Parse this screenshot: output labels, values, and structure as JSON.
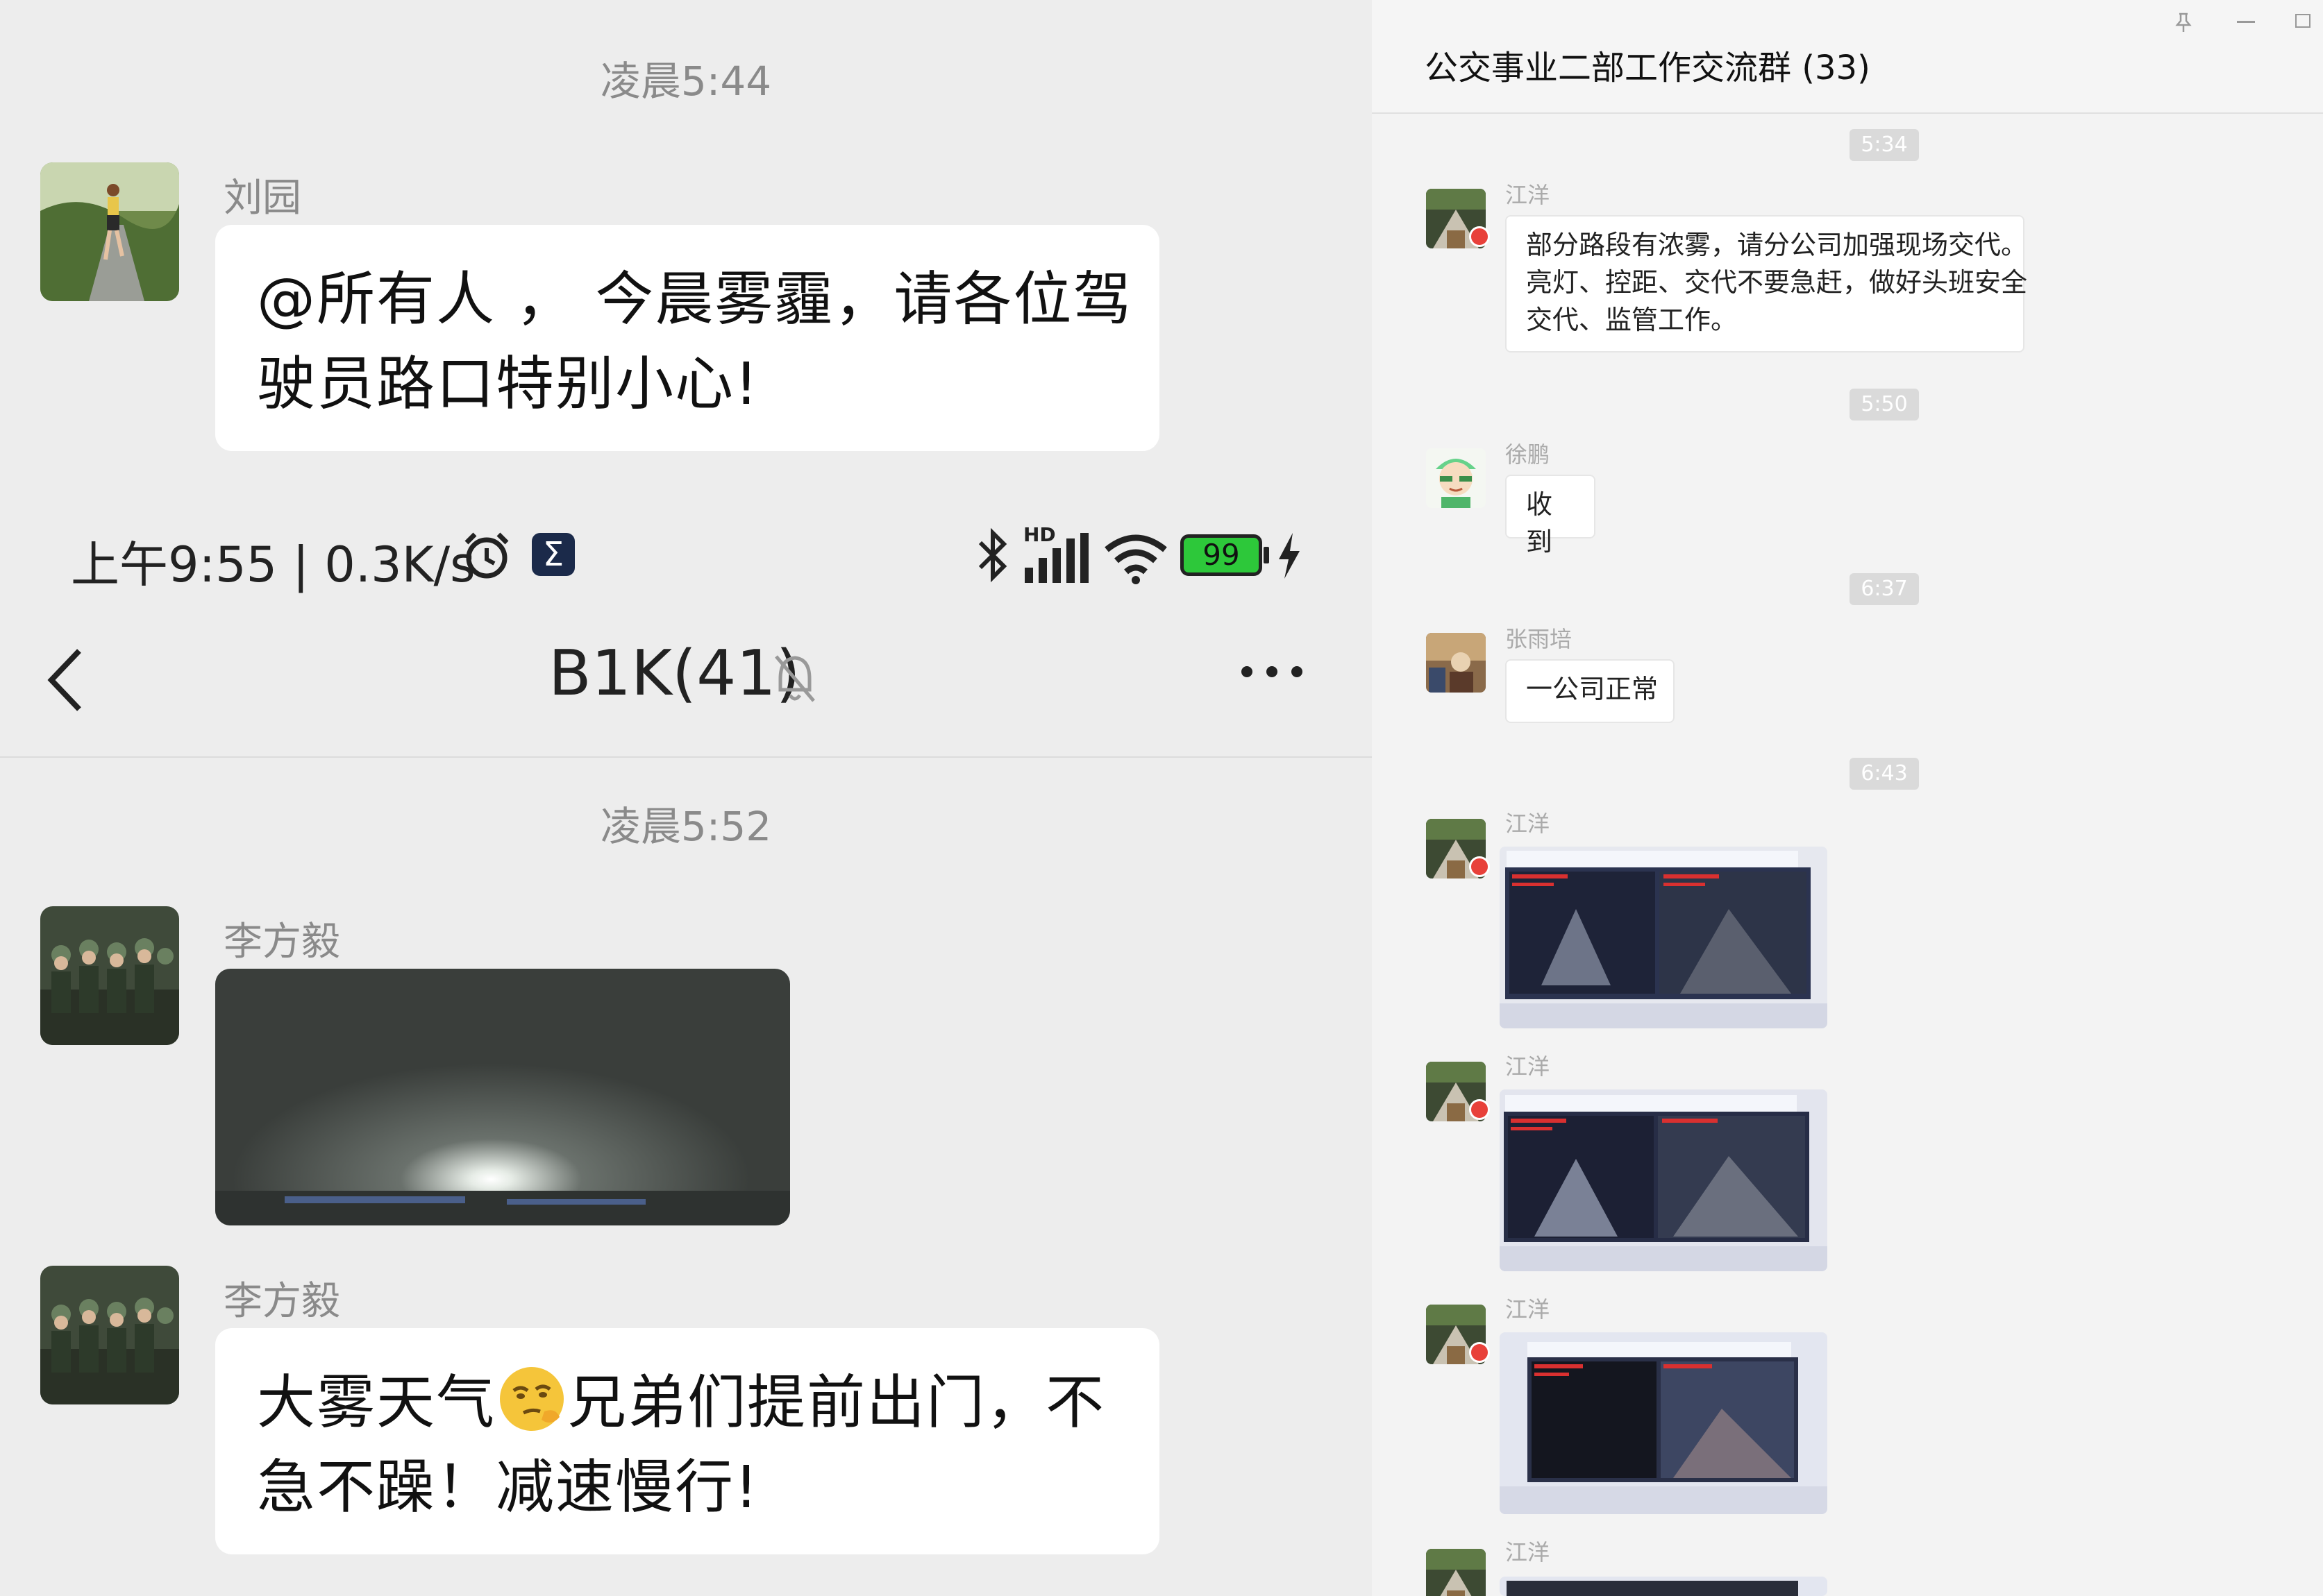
{
  "left": {
    "top_time": "凌晨5:44",
    "msg1": {
      "sender": "刘园",
      "text_line1": "@所有人 ， 今晨雾霾，请各位驾",
      "text_line2": "驶员路口特别小心!"
    },
    "status_bar": {
      "time": "上午9:55 | 0.3K/s",
      "app_badge": "Σ",
      "hd": "HD",
      "battery": "99"
    },
    "chat_title": "B1K(41)",
    "mid_time": "凌晨5:52",
    "msg2": {
      "sender": "李方毅"
    },
    "msg3": {
      "sender": "李方毅",
      "text_line1_a": "大雾天气",
      "text_line1_b": "兄弟们提前出门，不",
      "text_line2": "急不躁！减速慢行!"
    }
  },
  "right": {
    "title": "公交事业二部工作交流群 (33)",
    "times": [
      "5:34",
      "5:50",
      "6:37",
      "6:43"
    ],
    "messages": [
      {
        "sender": "江洋",
        "lines": [
          "部分路段有浓雾，请分公司加强现场交代。",
          "亮灯、控距、交代不要急赶，做好头班安全",
          "交代、监管工作。"
        ]
      },
      {
        "sender": "徐鹏",
        "text": "收到"
      },
      {
        "sender": "张雨培",
        "text": "一公司正常"
      },
      {
        "sender": "江洋",
        "type": "image"
      },
      {
        "sender": "江洋",
        "type": "image"
      },
      {
        "sender": "江洋",
        "type": "image"
      },
      {
        "sender": "江洋",
        "type": "image"
      }
    ]
  },
  "icons": {
    "back": "chevron-left-icon",
    "mute": "bell-off-icon",
    "more": "more-dots-icon",
    "alarm": "alarm-icon",
    "bluetooth": "bluetooth-icon",
    "signal": "signal-icon",
    "wifi": "wifi-icon",
    "battery": "battery-icon",
    "charging": "bolt-icon",
    "pin": "pin-icon",
    "minimize": "minimize-icon",
    "maximize": "maximize-icon"
  },
  "colors": {
    "chat_bg": "#ededed",
    "bubble": "#ffffff",
    "battery_green": "#2dc83a",
    "unread_red": "#e8413a"
  }
}
